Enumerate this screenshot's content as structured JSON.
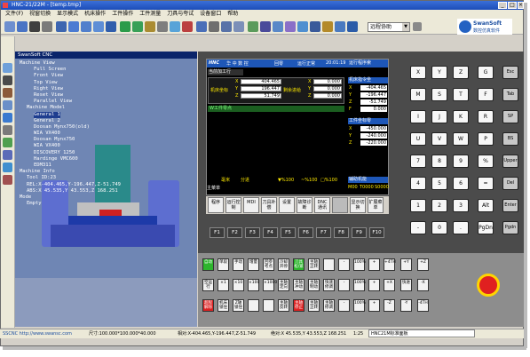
{
  "window": {
    "title": "HNC-21/22M - [temp.tmp]"
  },
  "menu": [
    "文件(F)",
    "视窗切换",
    "显示模式",
    "机床操作",
    "工件操作",
    "工件测量",
    "刀具与夸试",
    "设备窗口",
    "帮助"
  ],
  "toolbar": {
    "mode_value": "远程协助"
  },
  "logo": {
    "line1": "SwanSoft",
    "line2": "数控仿真软件"
  },
  "view3d": {
    "title": "SwanSoft CNC",
    "tree": [
      {
        "text": "Machine View",
        "indent": 0
      },
      {
        "text": "Full Screen",
        "indent": 2
      },
      {
        "text": "Front View",
        "indent": 2
      },
      {
        "text": "Top View",
        "indent": 2
      },
      {
        "text": "Right View",
        "indent": 2
      },
      {
        "text": "Reset View",
        "indent": 2
      },
      {
        "text": "Parallel View",
        "indent": 2
      },
      {
        "text": "Machine Model",
        "indent": 1
      },
      {
        "text": "General 1",
        "indent": 2,
        "selected": true
      },
      {
        "text": "General 2",
        "indent": 2
      },
      {
        "text": "Doosan Mynx750(old)",
        "indent": 2
      },
      {
        "text": "WIA VX400",
        "indent": 2
      },
      {
        "text": "Doosan Mynx750",
        "indent": 2
      },
      {
        "text": "WIA VX400",
        "indent": 2
      },
      {
        "text": "DISCOVERY 1250",
        "indent": 2
      },
      {
        "text": "Hardinge VMC600",
        "indent": 2
      },
      {
        "text": "EDM311",
        "indent": 2
      },
      {
        "text": "Machine Info",
        "indent": 0
      },
      {
        "text": "Tool ID:23",
        "indent": 1
      },
      {
        "text": "REL:X-404.465,Y-196.447,Z-51.749",
        "indent": 1
      },
      {
        "text": "ABS:X  45.535,Y  43.553,Z 168.251",
        "indent": 1
      },
      {
        "text": "Mode",
        "indent": 0
      },
      {
        "text": "Empty",
        "indent": 1
      }
    ]
  },
  "cnc": {
    "header": {
      "brand": "华 中 数 控",
      "mode": "回零",
      "state": "运行正常",
      "time": "20:01:19"
    },
    "current_tab": "当前加工行",
    "coord_labels": {
      "machine": "机床坐标",
      "left_move": "剩余进给"
    },
    "coord_rows": [
      {
        "ax": "X",
        "v1": "404.465",
        "v2": "0.000"
      },
      {
        "ax": "Y",
        "v1": "196.447",
        "v2": "0.000"
      },
      {
        "ax": "Z",
        "v1": "51.749",
        "v2": "0.000"
      }
    ],
    "work_zero_label": "W工件零点",
    "right": {
      "run_label": "运行程序索",
      "machine_label": "机床指令坐",
      "machine_vals": [
        {
          "ax": "X",
          "v": "-404.465"
        },
        {
          "ax": "Y",
          "v": "-196.447"
        },
        {
          "ax": "Z",
          "v": "-51.749"
        },
        {
          "ax": "F",
          "v": "0.000"
        }
      ],
      "work_label": "工件坐标零",
      "work_vals": [
        {
          "ax": "X",
          "v": "-450.000"
        },
        {
          "ax": "Y",
          "v": "-240.000"
        },
        {
          "ax": "Z",
          "v": "-220.000"
        }
      ],
      "aux_label": "辅助机能",
      "aux_vals": [
        "M00",
        "T0000",
        "S0000"
      ]
    },
    "status_line": {
      "a": "毫米",
      "b": "分进",
      "c": "▼%100 ",
      "d": "~%100",
      "e": "□%100"
    },
    "main_label": "主菜单",
    "softkeys": [
      "程序",
      "运行控制",
      "MDI",
      "刀具补偿",
      "设置",
      "故障诊断",
      "DNC通讯",
      "",
      "显示切换",
      "扩展菜单"
    ],
    "fkeys": [
      "F1",
      "F2",
      "F3",
      "F4",
      "F5",
      "F6",
      "F7",
      "F8",
      "F9",
      "F10"
    ]
  },
  "keyboard": {
    "rows": [
      [
        "X",
        "Y",
        "Z",
        "G",
        "Esc"
      ],
      [
        "M",
        "S",
        "T",
        "F",
        "Tab"
      ],
      [
        "I",
        "J",
        "K",
        "R",
        "SP"
      ],
      [
        "U",
        "V",
        "W",
        "P",
        "BS"
      ],
      [
        "7",
        "8",
        "9",
        "%",
        "Upper"
      ],
      [
        "4",
        "5",
        "6",
        "=",
        "Del"
      ],
      [
        "1",
        "2",
        "3",
        "Alt",
        "Enter"
      ],
      [
        "-",
        "0",
        ".",
        "PgDn",
        "Pgdn"
      ]
    ]
  },
  "operator": {
    "row1": [
      "自动",
      "单段",
      "手动",
      "增量",
      "回参考点",
      "冷却开停",
      "刀具松/紧",
      "主轴正转",
      "",
      "-",
      "100%",
      "+",
      "+4TH",
      "+Y",
      "+Z"
    ],
    "row2": [
      "空运行",
      "×1",
      "×10",
      "×100",
      "×1000",
      "主轴定向",
      "主轴冲动",
      "主轴制动",
      "快速修调",
      "-",
      "100%",
      "+",
      "+X",
      "快进",
      "-X"
    ],
    "row3": [
      "超程解除",
      "机床锁住",
      "Z轴锁住",
      "",
      "",
      "主轴反转",
      "主轴停止",
      "主轴正转",
      "主轴修调",
      "-",
      "100%",
      "+",
      "-Z",
      "-Y",
      "-4TH"
    ],
    "cycle_start": "循环启动",
    "feed_hold": "进给保持"
  },
  "statusbar": {
    "left": "SSCNC http://www.swansc.com",
    "size": "尺寸:100.000*100.000*40.000",
    "rel": "相对:X-404.465,Y-196.447,Z-51.749",
    "abs": "绝对:X 45.535,Y 43.553,Z 168.251",
    "zoom": "1:25",
    "panel": "HNC21M标准面板"
  }
}
